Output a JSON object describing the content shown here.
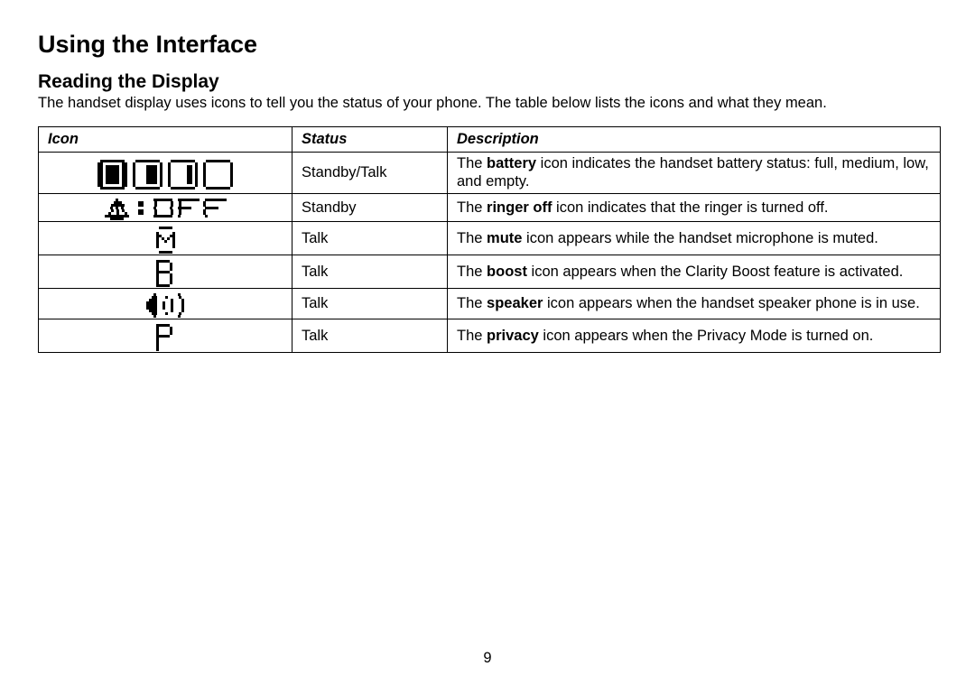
{
  "page_number": "9",
  "heading": "Using the Interface",
  "subheading": "Reading the Display",
  "intro": "The handset display uses icons to tell you the status of your phone. The table below lists the icons and what they mean.",
  "table": {
    "headers": {
      "icon": "Icon",
      "status": "Status",
      "description": "Description"
    },
    "rows": [
      {
        "icon_name": "icon-battery",
        "status": "Standby/Talk",
        "desc_pre": "The ",
        "desc_bold": "battery",
        "desc_post": " icon indicates the handset battery status: full, medium, low, and empty."
      },
      {
        "icon_name": "icon-ringer-off",
        "status": "Standby",
        "desc_pre": "The ",
        "desc_bold": "ringer off",
        "desc_post": " icon indicates that the ringer is turned off."
      },
      {
        "icon_name": "icon-mute",
        "status": "Talk",
        "desc_pre": "The ",
        "desc_bold": "mute",
        "desc_post": " icon appears while the handset microphone is muted."
      },
      {
        "icon_name": "icon-boost",
        "status": "Talk",
        "desc_pre": "The ",
        "desc_bold": "boost",
        "desc_post": " icon appears when the Clarity Boost feature is activated."
      },
      {
        "icon_name": "icon-speaker",
        "status": "Talk",
        "desc_pre": "The ",
        "desc_bold": "speaker",
        "desc_post": " icon appears when the handset speaker phone is in use."
      },
      {
        "icon_name": "icon-privacy",
        "status": "Talk",
        "desc_pre": "The ",
        "desc_bold": "privacy",
        "desc_post": " icon appears when the Privacy Mode is turned on."
      }
    ]
  },
  "pixel_icons": {
    "icon-battery": [
      "oXXXXXXXXXooooXXXXXXXXXooooXXXXXXXXXooooXXXXXXXXXo",
      "XXoooooooXXooXoooooooooXooXoooooooooXooXoooooooooX",
      "XXoXXXXXoXXooXooooXXXXoXooXooooooXXoXooXoooooooooX",
      "XXoXXXXXoXXooXooooXXXXoXooXooooooXXoXooXoooooooooX",
      "XXoXXXXXoXXooXooooXXXXoXooXooooooXXoXooXoooooooooX",
      "XXoXXXXXoXXooXooooXXXXoXooXooooooXXoXooXoooooooooX",
      "XXoXXXXXoXXooXooooXXXXoXooXooooooXXoXooXoooooooooX",
      "XXoXXXXXoXXooXooooXXXXoXooXooooooXXoXooXoooooooooX",
      "XXoXXXXXoXXooXooooXXXXoXooXooooooXXoXooXoooooooooX",
      "XXoooooooXXooXoooooooooXooXoooooooooXooXoooooooooX",
      "oXXXXXXXXXooooXXXXXXXXXooooXXXXXXXXXooooXXXXXXXXXo"
    ],
    "icon-ringer-off": [
      "ooooXoooooooooooooXXXXXXXooXXXXXXXXooXXXXXXXX",
      "oooXXXooooooXXooooXoooooXooXooooooooXooooooo",
      "ooXXXXXoooooXXooooXoooooXooXooooooooXooooooo",
      "ooXoXoXoooooooooooXoooooXooXXXXXoooooXXXXXooo",
      "ooXoXoXoooooXXooooXoooooXooXooooooooXooooooo",
      "oXooXooXooooXXooooXoooooXooXooooooooXooooooo",
      "XXXXXXXXXoooooooooXXXXXXXooXoooooooooXooooooo",
      "ooXXXXXoooooooooooooooooooooooooooooooooooooo"
    ],
    "icon-mute": [
      "oXXXXXo",
      "ooooooo",
      "XoooooX",
      "XXoooXX",
      "XoXoXoX",
      "XooXooX",
      "XoooooX",
      "XoooooX",
      "ooooooo",
      "oXXXXXo"
    ],
    "icon-boost": [
      "XXXXXoo",
      "XooooXo",
      "XooooXo",
      "XooooXo",
      "XXXXXoo",
      "XooooXo",
      "XooooXo",
      "XooooXo",
      "XooooXo",
      "XXXXXoo"
    ],
    "icon-speaker": [
      "oooXooooooooXoo",
      "ooXXoooXooooXo",
      "oXXXoooooXoooX",
      "XXXXooXooXoooX",
      "XXXXooXooXoooX",
      "XXXXooXooXoooX",
      "oXXXoooooXoooX",
      "ooXXoooXooooXo",
      "oooXooooooooXoo"
    ],
    "icon-privacy": [
      "XXXXXoo",
      "XooooXo",
      "XooooXo",
      "XooooXo",
      "XXXXXoo",
      "Xoooooo",
      "Xoooooo",
      "Xoooooo",
      "Xoooooo",
      "Xoooooo"
    ]
  }
}
